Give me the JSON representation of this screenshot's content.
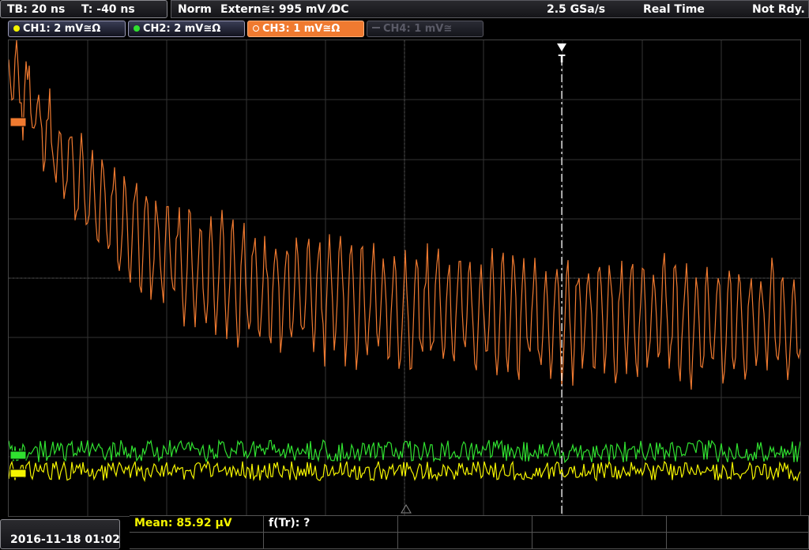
{
  "header": {
    "timebase": "TB: 20 ns",
    "trigger_offset": "T: -40 ns",
    "trigger_mode": "Norm",
    "trigger_source": "Extern≅: 995 mV ⁄DC",
    "sample_rate": "2.5 GSa/s",
    "acquisition_mode": "Real Time",
    "status": "Not Rdy."
  },
  "channels": [
    {
      "label": "CH1: 2 mV≅Ω",
      "color": "#f4f400",
      "state": "on"
    },
    {
      "label": "CH2: 2 mV≅Ω",
      "color": "#30e030",
      "state": "on"
    },
    {
      "label": "CH3: 1 mV≅Ω",
      "color": "#f07a30",
      "state": "active"
    },
    {
      "label": "CH4: 1 mV≅",
      "color": "#5a5a66",
      "state": "off"
    }
  ],
  "markers": {
    "trigger_label": "T"
  },
  "footer": {
    "datetime": "2016-11-18 01:02",
    "mean": "Mean: 85.92 µV",
    "freq": "f(Tr): ?"
  },
  "colors": {
    "ch1": "#f4f400",
    "ch2": "#30e030",
    "ch3": "#f07a30",
    "grid": "#333333"
  }
}
